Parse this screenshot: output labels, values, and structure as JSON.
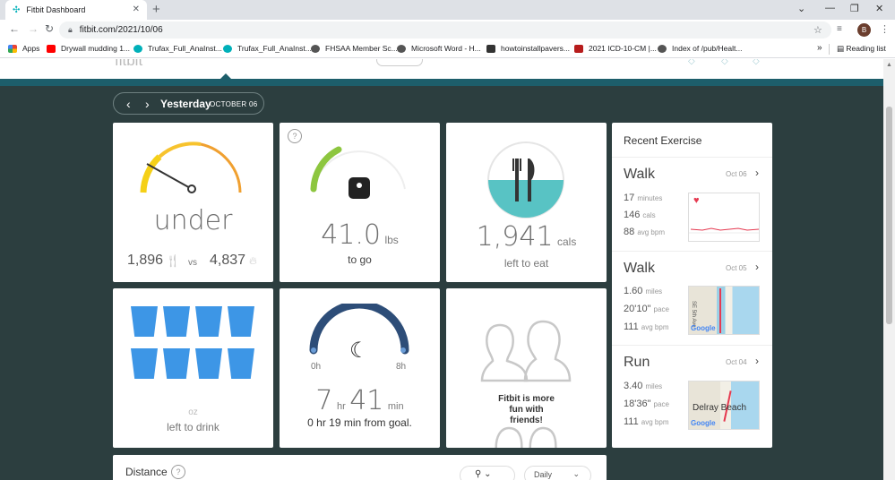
{
  "browser": {
    "tab_title": "Fitbit Dashboard",
    "url": "fitbit.com/2021/10/06",
    "avatar_letter": "B",
    "bookmarks": [
      {
        "label": "Apps",
        "color": "#e94235"
      },
      {
        "label": "Drywall mudding 1...",
        "color": "#ff0000"
      },
      {
        "label": "Trufax_Full_AnaInst...",
        "color": "#00b0b9"
      },
      {
        "label": "Trufax_Full_AnaInst...",
        "color": "#00b0b9"
      },
      {
        "label": "FHSAA Member Sc...",
        "color": "#555555"
      },
      {
        "label": "Microsoft Word - H...",
        "color": "#555555"
      },
      {
        "label": "howtoinstallpavers...",
        "color": "#333333"
      },
      {
        "label": "2021 ICD-10-CM |...",
        "color": "#b71c1c"
      },
      {
        "label": "Index of /pub/Healt...",
        "color": "#555555"
      }
    ],
    "more_bookmarks": "»",
    "reading_list": "Reading list"
  },
  "dashboard": {
    "logo_text": "fitbit",
    "date_label": "Yesterday",
    "date_sub": "OCTOBER 06",
    "calories_tile": {
      "status": "under",
      "food": "1,896",
      "vs": "vs",
      "burned": "4,837"
    },
    "weight_tile": {
      "value": "41.0",
      "unit": "lbs",
      "caption": "to go",
      "help": "?"
    },
    "food_tile": {
      "value": "1,941",
      "unit": "cals",
      "caption": "left to eat"
    },
    "water_tile": {
      "unit": "oz",
      "caption": "left to drink",
      "glasses": 8
    },
    "sleep_tile": {
      "start": "0h",
      "end": "8h",
      "hours": "7",
      "hr_unit": "hr",
      "minutes": "41",
      "min_unit": "min",
      "caption": "0 hr 19 min from goal.",
      "progress": 0.96
    },
    "friends_tile": {
      "caption": "Fitbit is more fun with friends!"
    },
    "recent_exercise": {
      "title": "Recent Exercise",
      "items": [
        {
          "type": "Walk",
          "date": "Oct 06",
          "s1": "17",
          "u1": "minutes",
          "s2": "146",
          "u2": "cals",
          "s3": "88",
          "u3": "avg bpm"
        },
        {
          "type": "Walk",
          "date": "Oct 05",
          "s1": "1.60",
          "u1": "miles",
          "s2": "20'10\"",
          "u2": "pace",
          "s3": "111",
          "u3": "avg bpm",
          "map_text": "Google",
          "map_street": "SE 5th Ave"
        },
        {
          "type": "Run",
          "date": "Oct 04",
          "s1": "3.40",
          "u1": "miles",
          "s2": "18'36\"",
          "u2": "pace",
          "s3": "111",
          "u3": "avg bpm",
          "map_text": "Google",
          "map_city": "Delray Beach"
        }
      ]
    },
    "distance": {
      "title": "Distance",
      "help": "?",
      "period": "Daily"
    },
    "colors": {
      "bg": "#2c3e3f",
      "teal": "#1d5e6b",
      "water": "#3d96e6",
      "sleep": "#2d4d78",
      "accent": "#61c4c8"
    }
  }
}
